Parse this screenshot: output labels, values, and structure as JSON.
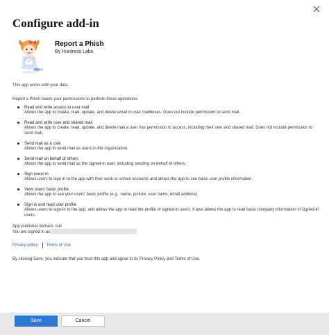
{
  "dialog": {
    "title": "Configure add-in",
    "close_icon": "close-icon"
  },
  "addin": {
    "name": "Report a Phish",
    "publisher": "By Huntress Labs",
    "icon": "mascot-logo-icon"
  },
  "intro": {
    "works_with": "This app works with your data.",
    "needs_permission": "Report a Phish needs your permissions to perform these operations:"
  },
  "permissions": [
    {
      "title": "Read and write access to user mail",
      "description": "Allows the app to create, read, update, and delete email in user mailboxes. Does not include permission to send mail."
    },
    {
      "title": "Read and write user and shared mail",
      "description": "Allows the app to create, read, update, and delete mail a user has permission to access, including their own and shared mail. Does not include permission to send mail."
    },
    {
      "title": "Send mail as a user",
      "description": "Allows the app to send mail as users in the organization."
    },
    {
      "title": "Send mail on behalf of others",
      "description": "Allows the app to send mail as the signed-in user, including sending on-behalf of others."
    },
    {
      "title": "Sign users in",
      "description": "Allows users to sign in to the app with their work or school accounts and allows the app to see basic user profile information."
    },
    {
      "title": "View users' basic profile",
      "description": "Allows the app to see your users' basic profile (e.g., name, picture, user name, email address)"
    },
    {
      "title": "Sign in and read user profile",
      "description": "Allows users to sign-in to the app, and allows the app to read the profile of signed-in users. It also allows the app to read basic company information of signed-in users."
    }
  ],
  "account": {
    "publisher_domain": "App publisher domain: null",
    "signed_in_label": "You are signed in as:"
  },
  "links": {
    "privacy": "Privacy policy",
    "terms": "Terms of Use"
  },
  "consent_text": "By clicking Save, you indicate that you trust this app and agree to its Privacy Policy and Terms of Use.",
  "footer": {
    "save_label": "Save",
    "cancel_label": "Cancel"
  },
  "colors": {
    "accent": "#2b78d6",
    "link": "#2a62c9",
    "footer_bg": "#e8e8e8"
  }
}
